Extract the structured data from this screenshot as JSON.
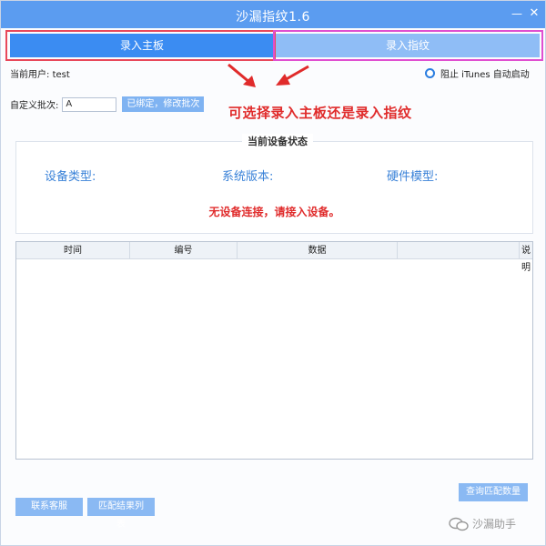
{
  "window": {
    "title": "沙漏指纹1.6"
  },
  "tabs": [
    {
      "label": "录入主板"
    },
    {
      "label": "录入指纹"
    }
  ],
  "user": {
    "label": "当前用户:",
    "value": "test"
  },
  "itunes": {
    "label": "阻止 iTunes 自动启动"
  },
  "batch": {
    "label": "自定义批次:",
    "value": "A",
    "button": "已绑定，修改批次"
  },
  "annotation": "可选择录入主板还是录入指纹",
  "device_status": {
    "title": "当前设备状态",
    "device_type": "设备类型:",
    "system_version": "系统版本:",
    "hardware_model": "硬件模型:",
    "message": "无设备连接，请接入设备。"
  },
  "table": {
    "columns": [
      "时间",
      "编号",
      "数据",
      "",
      "说明"
    ]
  },
  "buttons": {
    "contact": "联系客服",
    "results": "匹配结果列表",
    "query": "查询匹配数量"
  },
  "watermark": "沙漏助手",
  "colors": {
    "titlebar": "#5b9cf0",
    "tab_active": "#3b8cf2",
    "tab_inactive": "#8fbdf6",
    "annotation": "#e02b2b",
    "highlight_red": "#e8485a",
    "highlight_pink": "#e04fd0"
  }
}
